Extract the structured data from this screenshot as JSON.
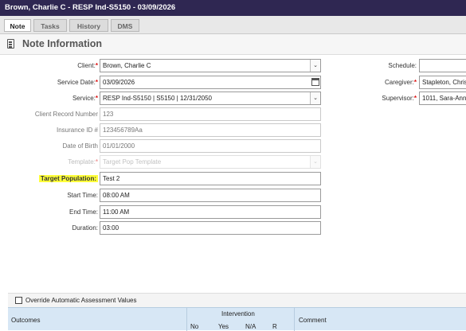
{
  "window": {
    "title": "Brown, Charlie C - RESP Ind-S5150 - 03/09/2026"
  },
  "tabs": [
    {
      "label": "Note",
      "active": true
    },
    {
      "label": "Tasks",
      "active": false
    },
    {
      "label": "History",
      "active": false
    },
    {
      "label": "DMS",
      "active": false
    }
  ],
  "section": {
    "title": "Note Information",
    "icon": "document-icon"
  },
  "form": {
    "client": {
      "label": "Client:",
      "required": "*",
      "value": "Brown, Charlie C"
    },
    "service_date": {
      "label": "Service Date:",
      "required": "*",
      "value": "03/09/2026"
    },
    "service": {
      "label": "Service:",
      "required": "*",
      "value": "RESP Ind-S5150 | S5150 | 12/31/2050"
    },
    "client_record_number": {
      "label": "Client Record Number",
      "value": "123"
    },
    "insurance_id": {
      "label": "Insurance ID #",
      "value": "123456789Aa"
    },
    "date_of_birth": {
      "label": "Date of Birth",
      "value": "01/01/2000"
    },
    "template": {
      "label": "Template:",
      "required": "*",
      "placeholder": "Target Pop Template"
    },
    "target_population": {
      "label": "Target Population:",
      "value": "Test 2"
    },
    "start_time": {
      "label": "Start Time:",
      "value": "08:00 AM"
    },
    "end_time": {
      "label": "End Time:",
      "value": "11:00 AM"
    },
    "duration": {
      "label": "Duration:",
      "value": "03:00"
    },
    "schedule": {
      "label": "Schedule:",
      "value": ""
    },
    "caregiver": {
      "label": "Caregiver:",
      "required": "*",
      "value": "Stapleton, Chris"
    },
    "supervisor": {
      "label": "Supervisor:",
      "required": "*",
      "value": "1011, Sara-Anne"
    }
  },
  "override": {
    "label": "Override Automatic Assessment Values",
    "checked": false
  },
  "assessment_table": {
    "outcomes_header": "Outcomes",
    "intervention_header": "Intervention",
    "columns": [
      "No",
      "Yes",
      "N/A",
      "R"
    ],
    "comment_header": "Comment"
  },
  "colors": {
    "titlebar": "#2f2752",
    "highlight": "#ffff3a",
    "required": "#dd1111",
    "table_header": "#d7e7f5"
  }
}
